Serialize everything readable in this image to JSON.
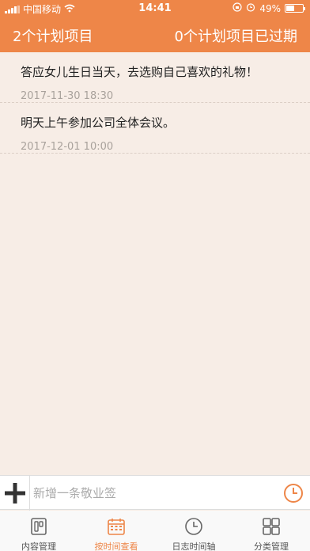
{
  "status_bar": {
    "carrier": "中国移动",
    "time": "14:41",
    "battery": "49%",
    "battery_level": 0.49
  },
  "header": {
    "plan_count_text": "2个计划项目",
    "overdue_text": "0个计划项目已过期"
  },
  "items": [
    {
      "title": "答应女儿生日当天，去选购自己喜欢的礼物！",
      "time": "2017-11-30 18:30"
    },
    {
      "title": "明天上午参加公司全体会议。",
      "time": "2017-12-01 10:00"
    }
  ],
  "input": {
    "placeholder": "新增一条敬业签"
  },
  "tabs": [
    {
      "label": "内容管理",
      "icon": "content-icon"
    },
    {
      "label": "按时间查看",
      "icon": "calendar-icon",
      "active": true
    },
    {
      "label": "日志时间轴",
      "icon": "clock-icon"
    },
    {
      "label": "分类管理",
      "icon": "grid-icon"
    }
  ],
  "colors": {
    "accent": "#ee8648",
    "background": "#f7ede6"
  }
}
